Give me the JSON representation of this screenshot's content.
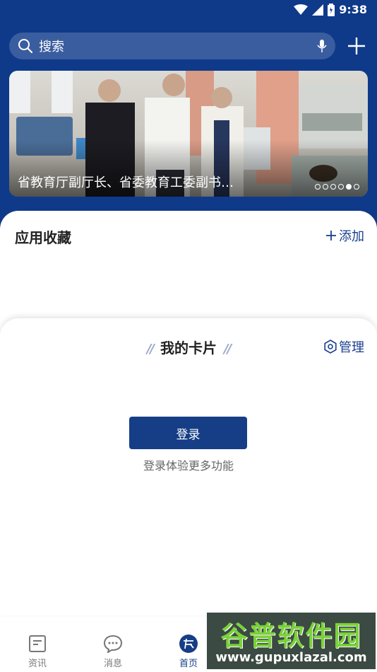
{
  "status": {
    "time": "9:38"
  },
  "search": {
    "placeholder": "搜索"
  },
  "banner": {
    "caption": "省教育厅副厅长、省委教育工委副书…",
    "dot_count": 6,
    "active_dot": 4
  },
  "favorites": {
    "title": "应用收藏",
    "add_label": "添加"
  },
  "cards": {
    "title": "我的卡片",
    "manage_label": "管理",
    "login_button": "登录",
    "login_hint": "登录体验更多功能"
  },
  "tabs": [
    {
      "label": "资讯",
      "icon": "news-icon"
    },
    {
      "label": "消息",
      "icon": "chat-bubble-icon"
    },
    {
      "label": "首页",
      "icon": "home-logo-icon",
      "active": true
    }
  ],
  "watermark": {
    "name": "谷普软件园",
    "url": "www.gupuxlazal.com"
  },
  "colors": {
    "primary": "#0f3a8a",
    "button": "#163e86",
    "accent_text": "#1a3f8f"
  }
}
